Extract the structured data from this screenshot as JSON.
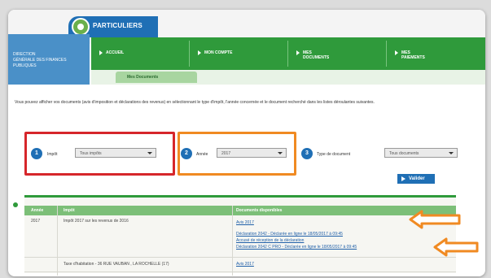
{
  "brand": {
    "title": "PARTICULIERS",
    "accent": "#1f6fb5",
    "nav_color": "#2f9a3b"
  },
  "org": {
    "lines": [
      "DIRECTION",
      "GÉNÉRALE DES FINANCES",
      "PUBLIQUES"
    ]
  },
  "nav": [
    {
      "label": "ACCUEIL"
    },
    {
      "label": "MON COMPTE"
    },
    {
      "label": "MES DOCUMENTS"
    },
    {
      "label": "MES PAIEMENTS"
    }
  ],
  "subnav": {
    "active_tab": "Mes Documents"
  },
  "intro_text": "Vous pouvez afficher vos documents (avis d'imposition et déclarations des revenus) en sélectionnant le type d'impôt, l'année concernée et le document recherché dans les listes déroulantes suivantes.",
  "filters": [
    {
      "step": "1",
      "label": "Impôt",
      "value": "Tous impôts"
    },
    {
      "step": "2",
      "label": "Année",
      "value": "2017"
    },
    {
      "step": "3",
      "label": "Type de document",
      "value": "Tous documents"
    }
  ],
  "validate_label": "Valider",
  "table": {
    "headers": [
      "Année",
      "Impôt",
      "Documents disponibles"
    ],
    "rows": [
      {
        "year": "2017",
        "tax": "Impôt 2017 sur les revenus de 2016",
        "docs": [
          "Avis 2017",
          "Déclaration 2042 - Déclarée en ligne le 18/05/2017 à 09:45",
          "Accusé de réception de la déclaration",
          "Déclaration 2042 C PRO - Déclarée en ligne le 18/05/2017 à 09:45"
        ]
      },
      {
        "year": "",
        "tax": "Taxe d'habitation - 36 RUE VAUBAN , LA ROCHELLE (17)",
        "docs": [
          "Avis 2017"
        ]
      }
    ]
  },
  "annotation_colors": {
    "red": "#d6262b",
    "orange": "#f08a22"
  }
}
